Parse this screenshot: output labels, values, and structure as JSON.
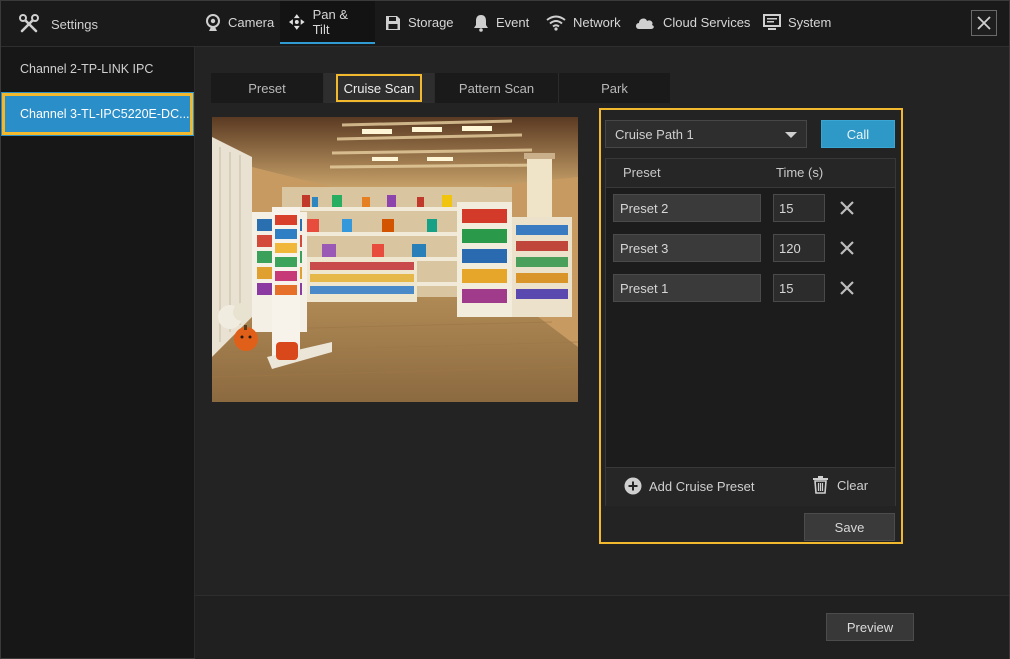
{
  "header": {
    "settings_label": "Settings",
    "tabs": [
      {
        "label": "Camera",
        "icon": "camera-icon"
      },
      {
        "label": "Pan & Tilt",
        "icon": "pan-tilt-icon"
      },
      {
        "label": "Storage",
        "icon": "storage-icon"
      },
      {
        "label": "Event",
        "icon": "bell-icon"
      },
      {
        "label": "Network",
        "icon": "wifi-icon"
      },
      {
        "label": "Cloud Services",
        "icon": "cloud-icon"
      },
      {
        "label": "System",
        "icon": "monitor-icon"
      }
    ],
    "active_tab": "Pan & Tilt"
  },
  "sidebar": {
    "items": [
      {
        "label": "Channel 2-TP-LINK IPC"
      },
      {
        "label": "Channel 3-TL-IPC5220E-DC..."
      }
    ],
    "active_index": 1
  },
  "subtabs": {
    "items": [
      {
        "label": "Preset"
      },
      {
        "label": "Cruise Scan"
      },
      {
        "label": "Pattern Scan"
      },
      {
        "label": "Park"
      }
    ],
    "active_index": 1
  },
  "cruise": {
    "path_selected": "Cruise Path 1",
    "call_label": "Call",
    "col_preset": "Preset",
    "col_time": "Time (s)",
    "rows": [
      {
        "preset": "Preset 2",
        "time": "15"
      },
      {
        "preset": "Preset 3",
        "time": "120"
      },
      {
        "preset": "Preset 1",
        "time": "15"
      }
    ],
    "add_label": "Add Cruise Preset",
    "clear_label": "Clear",
    "save_label": "Save"
  },
  "footer": {
    "preview_label": "Preview"
  },
  "colors": {
    "accent": "#2e98c6",
    "highlight": "#f2b92e",
    "background": "#232323"
  }
}
